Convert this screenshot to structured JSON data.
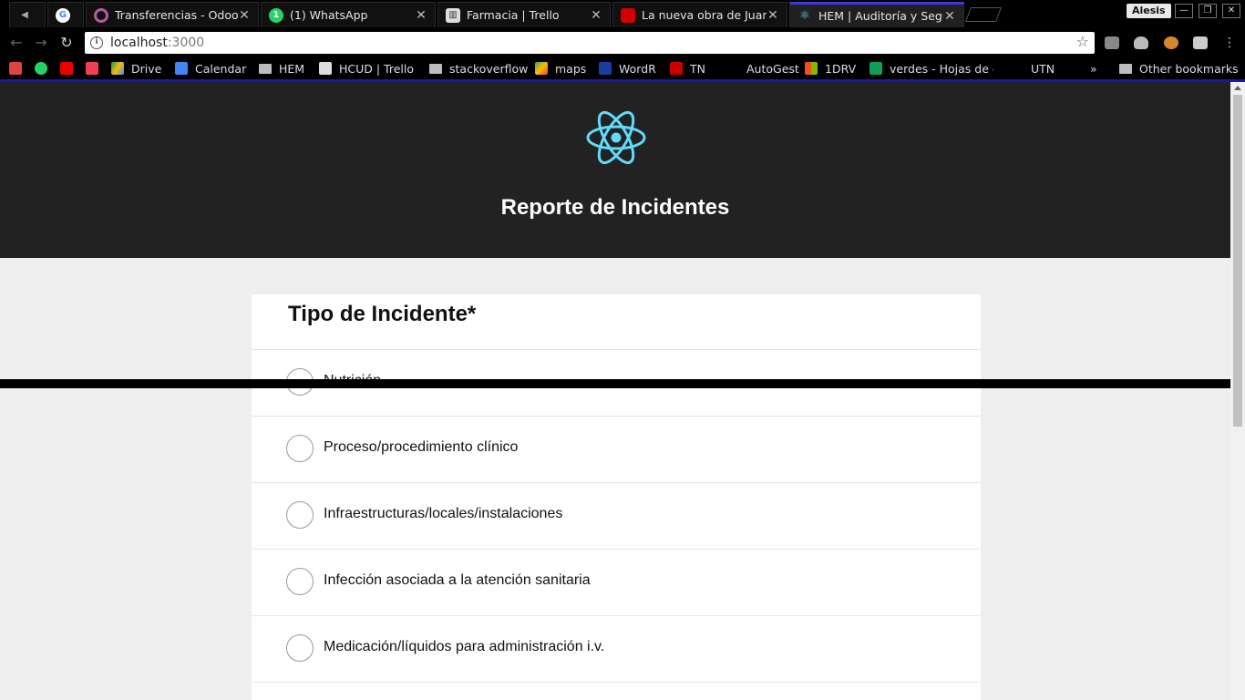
{
  "browser": {
    "tabs": [
      {
        "title": ""
      },
      {
        "title": "Transferencias - Odoo"
      },
      {
        "title": "(1) WhatsApp"
      },
      {
        "title": "Farmacia | Trello"
      },
      {
        "title": "La nueva obra de Juan Ju"
      },
      {
        "title": "HEM | Auditoría y Segu"
      }
    ],
    "profile_name": "Alesis",
    "url_host": "localhost",
    "url_port": ":3000",
    "bookmarks": [
      "Drive",
      "Calendar",
      "HEM",
      "HCUD | Trello",
      "stackoverflow",
      "maps",
      "WordR",
      "TN",
      "AutoGest",
      "1DRV",
      "verdes - Hojas de c",
      "UTN"
    ],
    "other_bookmarks": "Other bookmarks",
    "more_bookmarks": "»",
    "colors": {
      "accent": "#1b14b8",
      "react": "#61dafb",
      "header_bg": "#222222"
    }
  },
  "app": {
    "title": "Reporte de Incidentes",
    "section_title": "Tipo de Incidente*",
    "options": [
      "Nutrición",
      "Proceso/procedimiento clínico",
      "Infraestructuras/locales/instalaciones",
      "Infección asociada a la atención sanitaria",
      "Medicación/líquidos para administración i.v."
    ]
  }
}
